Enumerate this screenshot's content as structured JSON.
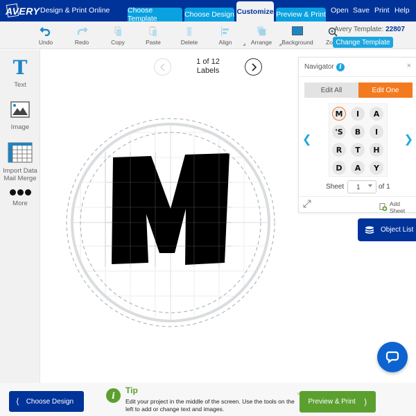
{
  "header": {
    "logo": "AVERY",
    "app_name": "Design & Print Online",
    "tabs": [
      {
        "label": "Choose Template",
        "active": false
      },
      {
        "label": "Choose Design",
        "active": false
      },
      {
        "label": "Customize",
        "active": true
      },
      {
        "label": "Preview & Print",
        "active": false
      }
    ],
    "links": [
      "Open",
      "Save",
      "Print",
      "Help"
    ]
  },
  "toolbar": {
    "items": [
      {
        "label": "Undo",
        "icon": "undo-icon"
      },
      {
        "label": "Redo",
        "icon": "redo-icon"
      },
      {
        "label": "Copy",
        "icon": "copy-icon"
      },
      {
        "label": "Paste",
        "icon": "paste-icon"
      },
      {
        "label": "Delete",
        "icon": "trash-icon"
      },
      {
        "label": "Align",
        "icon": "align-icon"
      },
      {
        "label": "Arrange",
        "icon": "arrange-icon"
      },
      {
        "label": "Background",
        "icon": "background-icon"
      },
      {
        "label": "Zo",
        "icon": "zoom-icon"
      }
    ],
    "template_prefix": "Avery Template:",
    "template_number": "22807",
    "change_template": "Change Template"
  },
  "sidebar": {
    "items": [
      {
        "label": "Text",
        "icon": "text-icon"
      },
      {
        "label": "Image",
        "icon": "image-icon"
      },
      {
        "label": "Import Data",
        "label2": "Mail Merge",
        "icon": "table-icon"
      },
      {
        "label": "More",
        "icon": "more-icon"
      }
    ]
  },
  "pager": {
    "line1": "1 of 12",
    "line2": "Labels"
  },
  "canvas": {
    "letter": "M"
  },
  "navigator": {
    "title": "Navigator",
    "info": "i",
    "close": "×",
    "edit_all": "Edit All",
    "edit_one": "Edit One",
    "thumbnails": [
      "M",
      "I",
      "A",
      "'S",
      "B",
      "I",
      "R",
      "T",
      "H",
      "D",
      "A",
      "Y"
    ],
    "selected_index": 0,
    "sheet_label": "Sheet",
    "sheet_value": "1",
    "sheet_of": "of 1",
    "add_sheet": "Add Sheet"
  },
  "object_list": "Object List",
  "bottom": {
    "choose_design": "Choose Design",
    "tip_title": "Tip",
    "tip_text": "Edit your project in the middle of the screen. Use the tools on the left to add or change text and images.",
    "tip_close": "×",
    "preview_print": "Preview & Print"
  },
  "colors": {
    "brand_blue": "#003399",
    "tab_cyan": "#0aa1e0",
    "accent_orange": "#f47a20",
    "tip_green": "#5ba02f"
  }
}
